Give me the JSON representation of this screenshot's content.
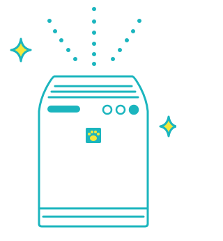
{
  "illustration": {
    "subject": "air-purifier",
    "colors": {
      "stroke": "#1bb5be",
      "accent": "#f4e83a",
      "background": "#ffffff"
    },
    "icons": [
      "sparkle-icon",
      "paw-icon",
      "airflow-dots-icon"
    ]
  }
}
